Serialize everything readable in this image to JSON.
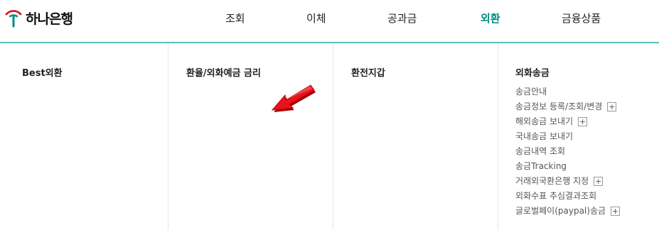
{
  "brand": {
    "logo_text": "하나은행",
    "logo_icon": "hana-bank-logo-icon",
    "accent_color": "#008c82",
    "red_color": "#e60012"
  },
  "gnb": {
    "items": [
      {
        "label": "조회",
        "active": false
      },
      {
        "label": "이체",
        "active": false
      },
      {
        "label": "공과금",
        "active": false
      },
      {
        "label": "외환",
        "active": true
      },
      {
        "label": "금융상품",
        "active": false
      }
    ]
  },
  "mega_menu": {
    "columns": [
      {
        "title": "Best외환"
      },
      {
        "title": "환율/외화예금 금리"
      },
      {
        "title": "환전지갑"
      },
      {
        "title": "외화송금",
        "items": [
          {
            "label": "송금안내",
            "expandable": false
          },
          {
            "label": "송금정보 등록/조회/변경",
            "expandable": true
          },
          {
            "label": "해외송금 보내기",
            "expandable": true
          },
          {
            "label": "국내송금 보내기",
            "expandable": false
          },
          {
            "label": "송금내역 조회",
            "expandable": false
          },
          {
            "label": "송금Tracking",
            "expandable": false
          },
          {
            "label": "거래외국환은행 지정",
            "expandable": true
          },
          {
            "label": "외화수표 추심결과조회",
            "expandable": false
          },
          {
            "label": "글로벌페이(paypal)송금",
            "expandable": true
          }
        ]
      }
    ],
    "expand_symbol": "+"
  },
  "annotation": {
    "arrow_icon": "red-arrow-icon",
    "arrow_color": "#e8131c"
  }
}
